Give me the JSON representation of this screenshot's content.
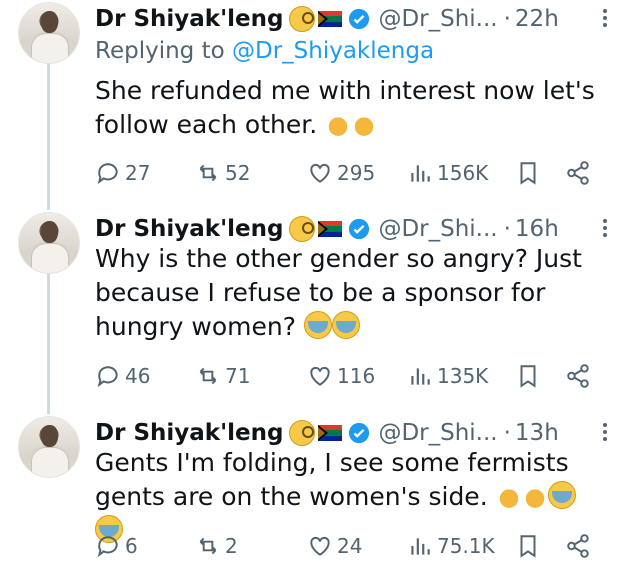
{
  "colors": {
    "text": "#0f1419",
    "muted": "#536471",
    "link": "#1d9bf0",
    "thread": "#cfd9de"
  },
  "tweets": [
    {
      "name": "Dr Shiyak'leng",
      "handle": "@Dr_Shi...",
      "separator": "·",
      "time": "22h",
      "reply_prefix": "Replying to ",
      "reply_handle": "@Dr_Shiyaklenga",
      "text": "She refunded me with interest now let's follow each other.",
      "emojis": [
        "pray-emoji",
        "pray-emoji"
      ],
      "stats": {
        "replies": "27",
        "retweets": "52",
        "likes": "295",
        "views": "156K"
      }
    },
    {
      "name": "Dr Shiyak'leng",
      "handle": "@Dr_Shi...",
      "separator": "·",
      "time": "16h",
      "text": "Why is the other gender so angry? Just because I refuse to be a sponsor for hungry women?",
      "emojis": [
        "sob-emoji",
        "sob-emoji"
      ],
      "stats": {
        "replies": "46",
        "retweets": "71",
        "likes": "116",
        "views": "135K"
      }
    },
    {
      "name": "Dr Shiyak'leng",
      "handle": "@Dr_Shi...",
      "separator": "·",
      "time": "13h",
      "text": "Gents I'm folding, I see some fermists gents are on the women's side.",
      "emojis": [
        "pray-emoji",
        "pray-emoji",
        "sob-emoji",
        "sob-emoji"
      ],
      "stats": {
        "replies": "6",
        "retweets": "2",
        "likes": "24",
        "views": "75.1K"
      }
    }
  ]
}
